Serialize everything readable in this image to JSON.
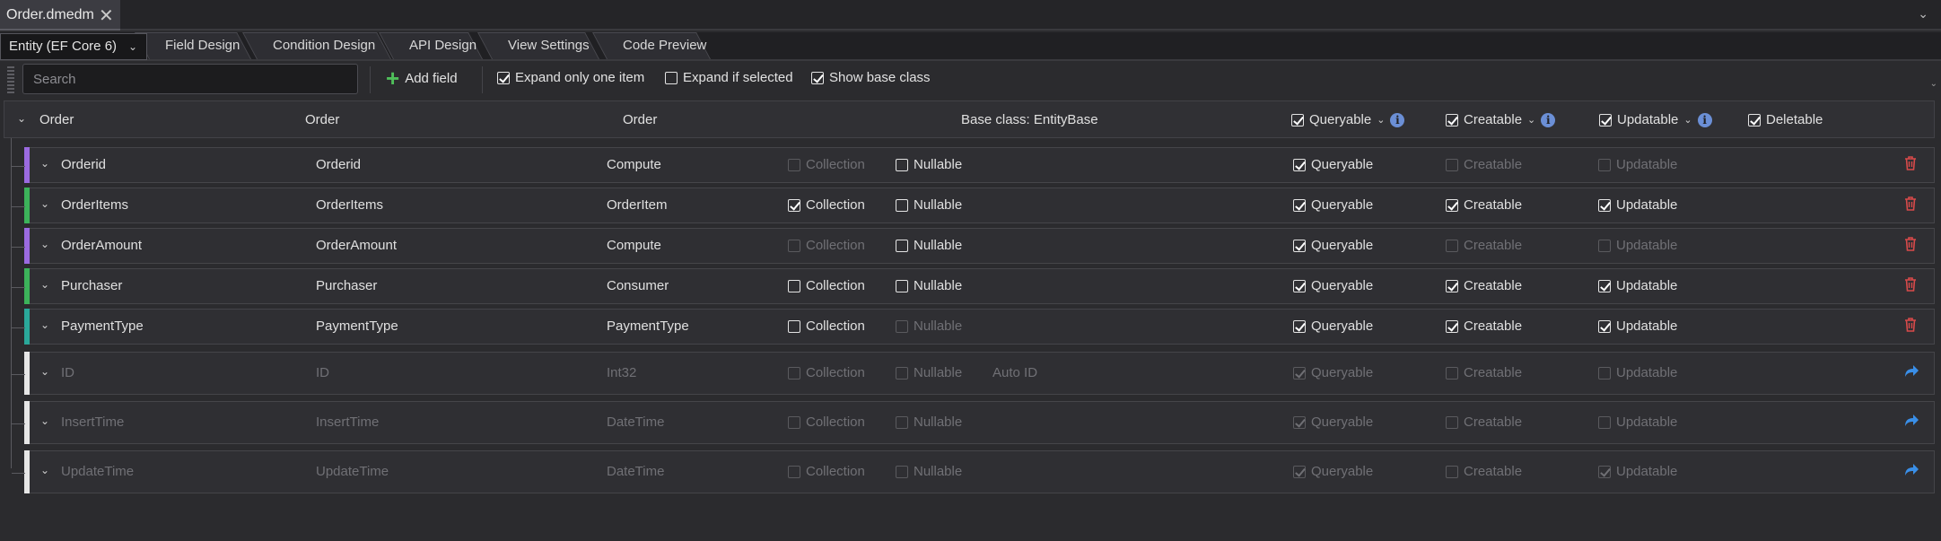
{
  "document_tab": {
    "title": "Order.dmedm",
    "close_glyph": "✕",
    "menu_glyph": "⌄"
  },
  "designer_tabs": {
    "entity_selector": "Entity (EF Core 6)",
    "tabs": [
      "Field Design",
      "Condition Design",
      "API Design",
      "View Settings",
      "Code Preview"
    ]
  },
  "toolbar": {
    "search_placeholder": "Search",
    "add_field": "Add field",
    "expand_only_one": {
      "label": "Expand only one item",
      "checked": true
    },
    "expand_if_selected": {
      "label": "Expand if selected",
      "checked": false
    },
    "show_base_class": {
      "label": "Show base class",
      "checked": true
    }
  },
  "entity_header": {
    "name": "Order",
    "display_name": "Order",
    "table": "Order",
    "base_class": "Base class: EntityBase",
    "queryable": {
      "label": "Queryable",
      "checked": true
    },
    "creatable": {
      "label": "Creatable",
      "checked": true
    },
    "updatable": {
      "label": "Updatable",
      "checked": true
    },
    "deletable": {
      "label": "Deletable",
      "checked": true
    }
  },
  "labels": {
    "collection": "Collection",
    "nullable": "Nullable",
    "queryable": "Queryable",
    "creatable": "Creatable",
    "updatable": "Updatable"
  },
  "fields": [
    {
      "name": "Orderid",
      "display": "Orderid",
      "type": "Compute",
      "accent": "#9b6ae0",
      "inherited": false,
      "collection": {
        "checked": false,
        "disabled": true
      },
      "nullable": {
        "checked": false,
        "disabled": false
      },
      "extra": "",
      "queryable": {
        "checked": true,
        "disabled": false
      },
      "creatable": {
        "checked": false,
        "disabled": true
      },
      "updatable": {
        "checked": false,
        "disabled": true
      },
      "action_icon": "trash-icon"
    },
    {
      "name": "OrderItems",
      "display": "OrderItems",
      "type": "OrderItem",
      "accent": "#3cb35a",
      "inherited": false,
      "collection": {
        "checked": true,
        "disabled": false
      },
      "nullable": {
        "checked": false,
        "disabled": false
      },
      "extra": "",
      "queryable": {
        "checked": true,
        "disabled": false
      },
      "creatable": {
        "checked": true,
        "disabled": false
      },
      "updatable": {
        "checked": true,
        "disabled": false
      },
      "action_icon": "trash-icon"
    },
    {
      "name": "OrderAmount",
      "display": "OrderAmount",
      "type": "Compute",
      "accent": "#9b6ae0",
      "inherited": false,
      "collection": {
        "checked": false,
        "disabled": true
      },
      "nullable": {
        "checked": false,
        "disabled": false
      },
      "extra": "",
      "queryable": {
        "checked": true,
        "disabled": false
      },
      "creatable": {
        "checked": false,
        "disabled": true
      },
      "updatable": {
        "checked": false,
        "disabled": true
      },
      "action_icon": "trash-icon"
    },
    {
      "name": "Purchaser",
      "display": "Purchaser",
      "type": "Consumer",
      "accent": "#3cb35a",
      "inherited": false,
      "collection": {
        "checked": false,
        "disabled": false
      },
      "nullable": {
        "checked": false,
        "disabled": false
      },
      "extra": "",
      "queryable": {
        "checked": true,
        "disabled": false
      },
      "creatable": {
        "checked": true,
        "disabled": false
      },
      "updatable": {
        "checked": true,
        "disabled": false
      },
      "action_icon": "trash-icon"
    },
    {
      "name": "PaymentType",
      "display": "PaymentType",
      "type": "PaymentType",
      "accent": "#2aa89a",
      "inherited": false,
      "collection": {
        "checked": false,
        "disabled": false
      },
      "nullable": {
        "checked": false,
        "disabled": true
      },
      "extra": "",
      "queryable": {
        "checked": true,
        "disabled": false
      },
      "creatable": {
        "checked": true,
        "disabled": false
      },
      "updatable": {
        "checked": true,
        "disabled": false
      },
      "action_icon": "trash-icon"
    },
    {
      "name": "ID",
      "display": "ID",
      "type": "Int32",
      "accent": "#e6e6e6",
      "inherited": true,
      "collection": {
        "checked": false,
        "disabled": true
      },
      "nullable": {
        "checked": false,
        "disabled": true
      },
      "extra": "Auto ID",
      "queryable": {
        "checked": true,
        "disabled": true
      },
      "creatable": {
        "checked": false,
        "disabled": true
      },
      "updatable": {
        "checked": false,
        "disabled": true
      },
      "action_icon": "share-icon"
    },
    {
      "name": "InsertTime",
      "display": "InsertTime",
      "type": "DateTime",
      "accent": "#e6e6e6",
      "inherited": true,
      "collection": {
        "checked": false,
        "disabled": true
      },
      "nullable": {
        "checked": false,
        "disabled": true
      },
      "extra": "",
      "queryable": {
        "checked": true,
        "disabled": true
      },
      "creatable": {
        "checked": false,
        "disabled": true
      },
      "updatable": {
        "checked": false,
        "disabled": true
      },
      "action_icon": "share-icon"
    },
    {
      "name": "UpdateTime",
      "display": "UpdateTime",
      "type": "DateTime",
      "accent": "#e6e6e6",
      "inherited": true,
      "collection": {
        "checked": false,
        "disabled": true
      },
      "nullable": {
        "checked": false,
        "disabled": true
      },
      "extra": "",
      "queryable": {
        "checked": true,
        "disabled": true
      },
      "creatable": {
        "checked": false,
        "disabled": true
      },
      "updatable": {
        "checked": true,
        "disabled": true
      },
      "action_icon": "share-icon"
    }
  ]
}
